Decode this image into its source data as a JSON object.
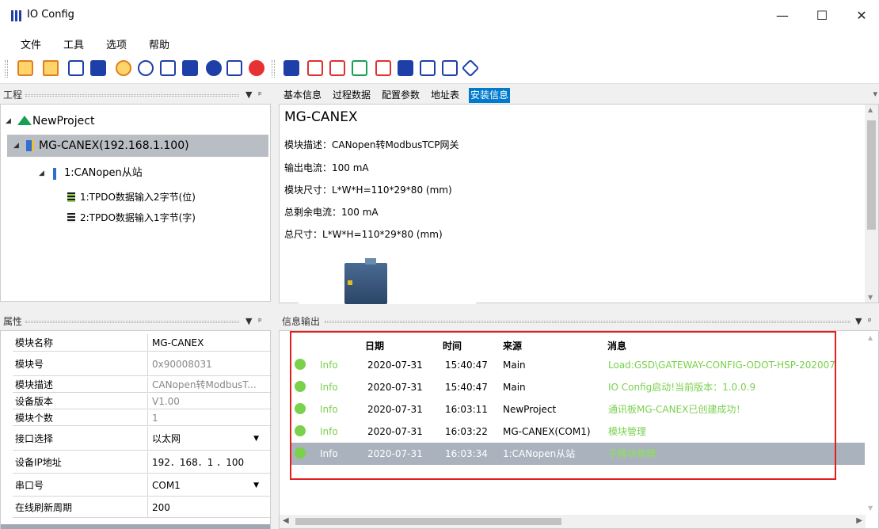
{
  "window": {
    "title": "IO Config",
    "minimize": "—",
    "maximize": "☐",
    "close": "✕"
  },
  "menu": [
    "文件",
    "工具",
    "选项",
    "帮助"
  ],
  "panels": {
    "project": "工程",
    "properties": "属性",
    "info_output": "信息输出"
  },
  "tree": {
    "project": "NewProject",
    "device": "MG-CANEX(192.168.1.100)",
    "slave": "1:CANopen从站",
    "pdo1": "1:TPDO数据输入2字节(位)",
    "pdo2": "2:TPDO数据输入1字节(字)"
  },
  "tabs": [
    "基本信息",
    "过程数据",
    "配置参数",
    "地址表",
    "安装信息"
  ],
  "install": {
    "name": "MG-CANEX",
    "lines": [
      "模块描述：CANopen转ModbusTCP网关",
      "输出电流：100 mA",
      "模块尺寸：L*W*H=110*29*80 (mm)",
      "总剩余电流：100 mA",
      "总尺寸：L*W*H=110*29*80 (mm)"
    ]
  },
  "properties": [
    {
      "k": "模块名称",
      "v": "MG-CANEX",
      "gray": false
    },
    {
      "k": "模块号",
      "v": "0x90008031",
      "gray": true
    },
    {
      "k": "模块描述",
      "v": "CANopen转ModbusT...",
      "gray": true
    },
    {
      "k": "设备版本",
      "v": "V1.00",
      "gray": true
    },
    {
      "k": "模块个数",
      "v": "1",
      "gray": true
    },
    {
      "k": "接口选择",
      "v": "以太网",
      "gray": false,
      "dropdown": true
    },
    {
      "k": "设备IP地址",
      "v": "192．168．1 ．100",
      "gray": false
    },
    {
      "k": "串口号",
      "v": "COM1",
      "gray": false,
      "dropdown": true
    },
    {
      "k": "在线刷新周期",
      "v": "200",
      "gray": false
    }
  ],
  "messages": {
    "headers": {
      "date": "日期",
      "time": "时间",
      "source": "来源",
      "message": "消息"
    },
    "rows": [
      {
        "level": "Info",
        "date": "2020-07-31",
        "time": "15:40:47",
        "source": "Main",
        "msg": "Load:GSD\\GATEWAY-CONFIG-ODOT-HSP-202007"
      },
      {
        "level": "Info",
        "date": "2020-07-31",
        "time": "15:40:47",
        "source": "Main",
        "msg": "IO Config启动!当前版本：1.0.0.9"
      },
      {
        "level": "Info",
        "date": "2020-07-31",
        "time": "16:03:11",
        "source": "NewProject",
        "msg": "通讯板MG-CANEX已创建成功！"
      },
      {
        "level": "Info",
        "date": "2020-07-31",
        "time": "16:03:22",
        "source": "MG-CANEX(COM1)",
        "msg": "模块管理"
      },
      {
        "level": "Info",
        "date": "2020-07-31",
        "time": "16:03:34",
        "source": "1:CANopen从站",
        "msg": "子模块管理"
      }
    ]
  },
  "colors": {
    "accent": "#007acc",
    "selection": "#a9b2bd",
    "info_green": "#7ad14c",
    "highlight_box": "#e02020"
  }
}
